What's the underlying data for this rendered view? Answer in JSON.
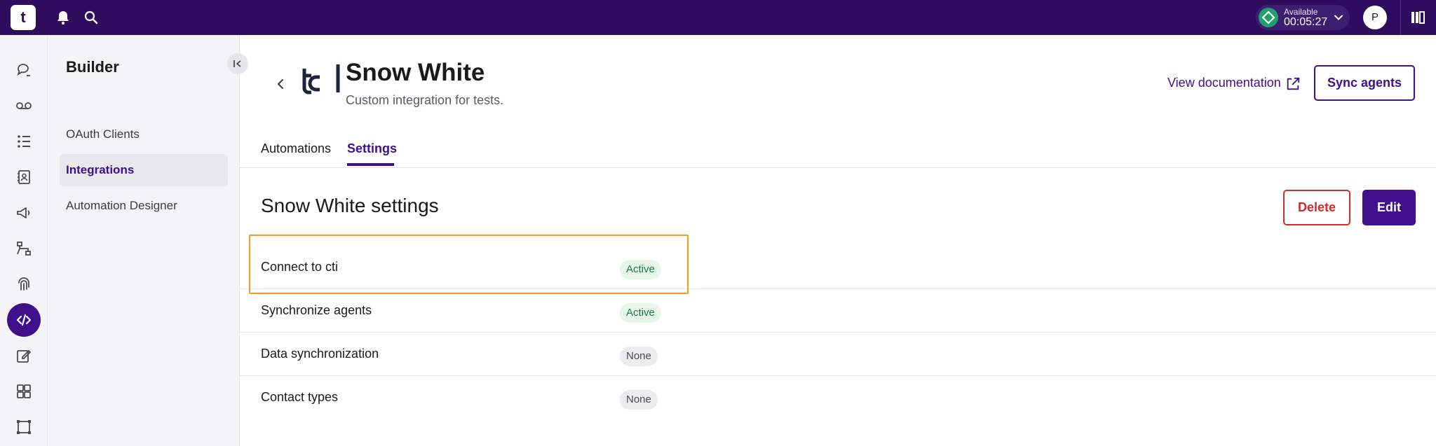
{
  "topbar": {
    "logo_text": "t",
    "status": {
      "label": "Available",
      "time": "00:05:27",
      "color": "#1fa16b"
    },
    "avatar_initial": "P"
  },
  "rail": {
    "icons": [
      "conversation-icon",
      "voicemail-icon",
      "numbered-list-icon",
      "contacts-book-icon",
      "megaphone-icon",
      "workflow-icon",
      "fingerprint-icon",
      "code-icon",
      "edit-note-icon",
      "dashboard-grid-icon",
      "selection-frame-icon"
    ],
    "active_index": 7
  },
  "sidebar": {
    "title": "Builder",
    "items": [
      {
        "label": "OAuth Clients",
        "active": false
      },
      {
        "label": "Integrations",
        "active": true
      },
      {
        "label": "Automation Designer",
        "active": false
      }
    ]
  },
  "header": {
    "title": "Snow White",
    "subtitle": "Custom integration for tests.",
    "doc_link": "View documentation",
    "sync_button": "Sync agents"
  },
  "tabs": [
    {
      "label": "Automations",
      "active": false
    },
    {
      "label": "Settings",
      "active": true
    }
  ],
  "settings": {
    "title": "Snow White settings",
    "delete_button": "Delete",
    "edit_button": "Edit",
    "rows": [
      {
        "label": "Connect to cti",
        "status": "Active"
      },
      {
        "label": "Synchronize agents",
        "status": "Active"
      },
      {
        "label": "Data synchronization",
        "status": "None"
      },
      {
        "label": "Contact types",
        "status": "None"
      }
    ]
  },
  "colors": {
    "topbar": "#2e0d5f",
    "accent": "#3f0f8c",
    "danger": "#d12b2b",
    "highlight": "#f59b1f"
  }
}
